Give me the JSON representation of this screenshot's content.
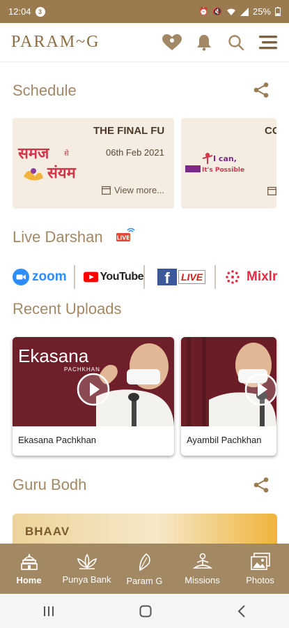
{
  "status_bar": {
    "time": "12:04",
    "notification_count": "3",
    "battery": "25%"
  },
  "app": {
    "logo": "PARAM~G"
  },
  "schedule": {
    "title": "Schedule",
    "cards": [
      {
        "title": "THE FINAL FU",
        "date": "06th Feb 2021",
        "more": "View more..."
      },
      {
        "title": "CO"
      }
    ]
  },
  "live_darshan": {
    "title": "Live Darshan",
    "badge": "LIVE",
    "platforms": [
      {
        "name": "zoom",
        "icon": "zoom-icon"
      },
      {
        "name": "YouTube",
        "icon": "youtube-icon"
      },
      {
        "name": "LIVE",
        "icon": "facebook-icon"
      },
      {
        "name": "Mixlr",
        "icon": "mixlr-icon"
      }
    ]
  },
  "recent_uploads": {
    "title": "Recent Uploads",
    "videos": [
      {
        "label": "Ekasana Pachkhan",
        "overlay_title": "Ekasana",
        "overlay_sub": "PACHKHAN"
      },
      {
        "label": "Ayambil Pachkhan"
      }
    ]
  },
  "guru_bodh": {
    "title": "Guru Bodh",
    "banner": "BHAAV"
  },
  "bottom_nav": [
    {
      "label": "Home",
      "icon": "temple-icon",
      "active": true
    },
    {
      "label": "Punya Bank",
      "icon": "lotus-icon"
    },
    {
      "label": "Param G",
      "icon": "feather-icon"
    },
    {
      "label": "Missions",
      "icon": "meditation-icon"
    },
    {
      "label": "Photos",
      "icon": "photos-icon"
    }
  ],
  "colors": {
    "gold": "#9a7b4f",
    "nav_bg": "#a38864",
    "section_title": "#a38866",
    "card_bg": "#f6ede2"
  }
}
